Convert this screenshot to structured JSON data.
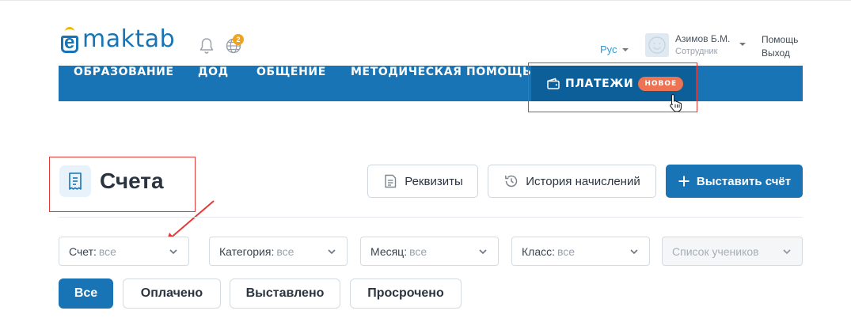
{
  "header": {
    "logo_text": "maktab",
    "notifications_badge": "2",
    "language": "Рус",
    "user_name": "Азимов Б.М.",
    "user_role": "Сотрудник",
    "help_link": "Помощь",
    "logout_link": "Выход"
  },
  "nav": {
    "items": [
      "ОБРАЗОВАНИЕ",
      "ДОД",
      "ОБЩЕНИЕ",
      "МЕТОДИЧЕСКАЯ ПОМОЩЬ"
    ],
    "payments_label": "ПЛАТЕЖИ",
    "payments_badge": "НОВОЕ"
  },
  "page": {
    "title": "Счета",
    "requisites_button": "Реквизиты",
    "history_button": "История начислений",
    "issue_invoice_button": "Выставить счёт"
  },
  "filters": [
    {
      "label": "Счет:",
      "value": "все"
    },
    {
      "label": "Категория:",
      "value": "все"
    },
    {
      "label": "Месяц:",
      "value": "все"
    },
    {
      "label": "Класс:",
      "value": "все"
    },
    {
      "label": "Список учеников",
      "value": ""
    }
  ],
  "status_tabs": [
    "Все",
    "Оплачено",
    "Выставлено",
    "Просрочено"
  ],
  "colors": {
    "primary": "#1874b5",
    "nav_active": "#0d5f9a",
    "badge_new": "#ee7352",
    "highlight": "#e53935",
    "notification_badge": "#f0a41c"
  }
}
